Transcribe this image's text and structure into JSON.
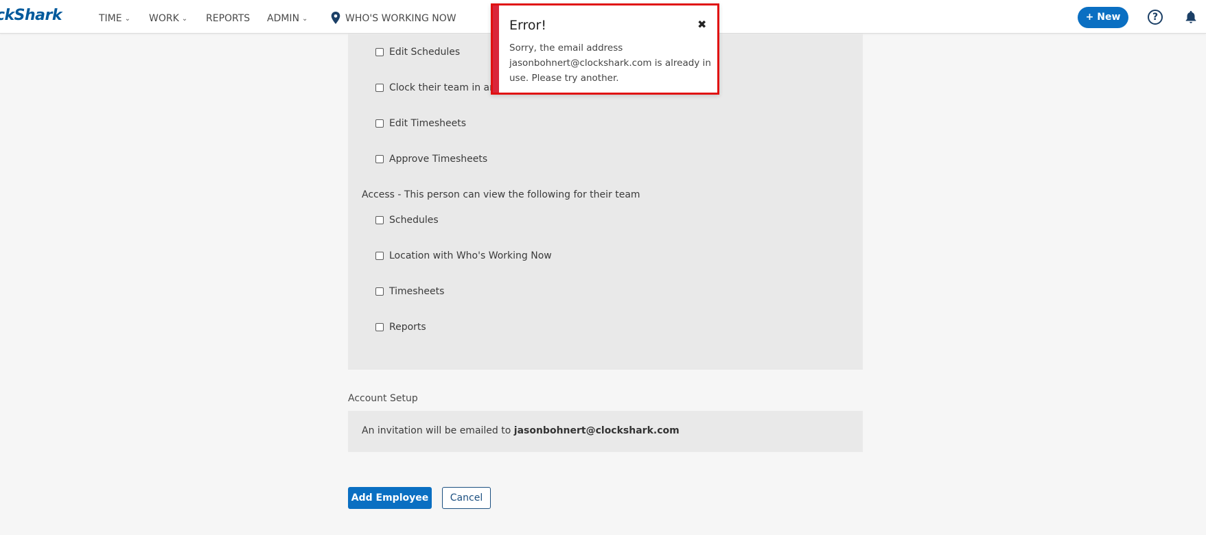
{
  "nav": {
    "logo": "ckShark",
    "items": [
      {
        "label": "TIME",
        "dropdown": true
      },
      {
        "label": "WORK",
        "dropdown": true
      },
      {
        "label": "REPORTS",
        "dropdown": false
      },
      {
        "label": "ADMIN",
        "dropdown": true
      },
      {
        "label": "WHO'S WORKING NOW",
        "icon": "location-pin-icon"
      }
    ],
    "new_label": "+ New",
    "help_label": "?",
    "accent_color": "#0a6fc2"
  },
  "permissions": {
    "manage_items": [
      "Edit Schedules",
      "Clock their team in and",
      "Edit Timesheets",
      "Approve Timesheets"
    ],
    "access_heading": "Access - This person can view the following for their team",
    "access_items": [
      "Schedules",
      "Location with Who's Working Now",
      "Timesheets",
      "Reports"
    ]
  },
  "account_setup": {
    "title": "Account Setup",
    "invite_prefix": "An invitation will be emailed to ",
    "email": "jasonbohnert@clockshark.com"
  },
  "actions": {
    "add_label": "Add Employee",
    "cancel_label": "Cancel"
  },
  "error_toast": {
    "title": "Error!",
    "close": "✖",
    "message": "Sorry, the email address jasonbohnert@clockshark.com is already in use. Please try another.",
    "bar_color": "#d9263a",
    "border_color": "#e01010"
  }
}
